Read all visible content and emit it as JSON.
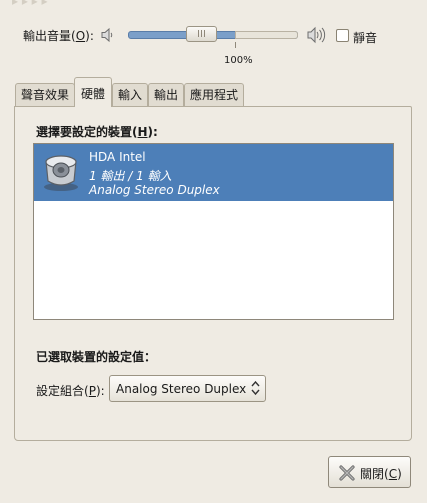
{
  "volume": {
    "label": "輸出音量(",
    "mnemonic": "O",
    "label_end": "):",
    "level": 1.0,
    "percent_label": "100%",
    "mute_label": "靜音",
    "mute_checked": false,
    "speaker_low_icon": "speaker-low-icon",
    "speaker_high_icon": "speaker-high-icon"
  },
  "tabs": [
    {
      "label": "聲音效果",
      "active": false
    },
    {
      "label": "硬體",
      "active": true
    },
    {
      "label": "輸入",
      "active": false
    },
    {
      "label": "輸出",
      "active": false
    },
    {
      "label": "應用程式",
      "active": false
    }
  ],
  "hardware": {
    "select_title": "選擇要設定的裝置(",
    "select_mnemonic": "H",
    "select_title_end": "):",
    "devices": [
      {
        "name": "HDA Intel",
        "ports": "1 輸出 / 1 輸入",
        "profile": "Analog Stereo Duplex",
        "selected": true,
        "icon": "audio-card-icon"
      }
    ],
    "settings_title": "已選取裝置的設定值：",
    "profile_label": "設定組合(",
    "profile_mnemonic": "P",
    "profile_label_end": "):",
    "profile_value": "Analog Stereo Duplex"
  },
  "footer": {
    "close_label": "關閉(",
    "close_mnemonic": "C",
    "close_label_end": ")",
    "close_icon": "close-icon"
  },
  "colors": {
    "selection": "#4d7fb8",
    "window_bg": "#efebe3",
    "slider_fill": "#7b9fc9"
  }
}
